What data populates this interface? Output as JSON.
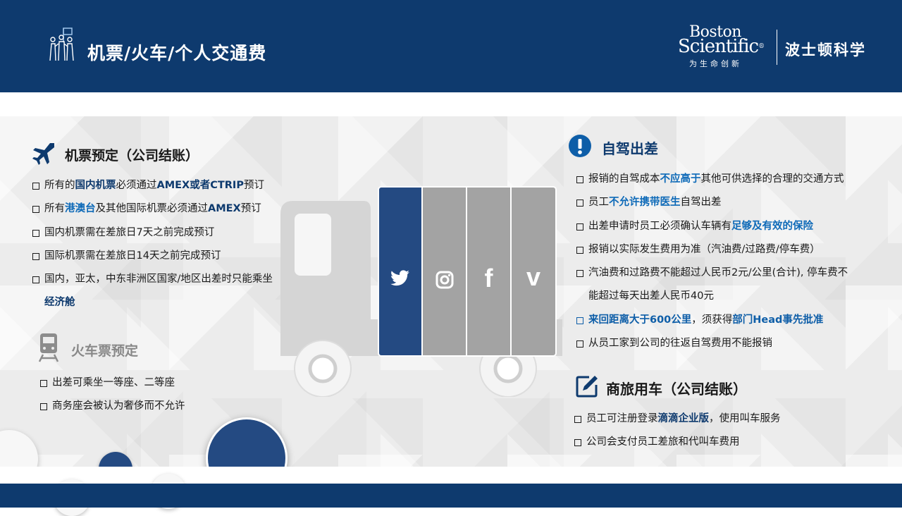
{
  "header": {
    "title": "机票/火车/个人交通费",
    "logo_line1": "Boston",
    "logo_line2": "Scientific",
    "logo_reg": "®",
    "logo_tagline": "为生命创新",
    "logo_cn": "波士顿科学"
  },
  "colors": {
    "navy": "#0e3a6e",
    "accent_blue": "#0e6ab8",
    "truck_grey": "#a3a3a3",
    "panel_navy": "#244a82"
  },
  "flight": {
    "title": "机票预定（公司结账）",
    "items": [
      [
        "所有的",
        "国内机票",
        "必须通过",
        "AMEX或者CTRIP",
        "预订"
      ],
      [
        "所有",
        "港澳台",
        "及其他国际机票必须通过",
        "AMEX",
        "预订"
      ],
      [
        "国内机票需在差旅日7天之前完成预订"
      ],
      [
        "国际机票需在差旅日14天之前完成预订"
      ],
      [
        "国内，亚太，中东非洲区国家/地区出差时只能乘坐"
      ],
      [
        "经济舱"
      ]
    ]
  },
  "train": {
    "title": "火车票预定",
    "items": [
      "出差可乘坐一等座、二等座",
      "商务座会被认为奢侈而不允许"
    ]
  },
  "truck": {
    "panels": [
      {
        "icon": "twitter-icon"
      },
      {
        "icon": "instagram-icon"
      },
      {
        "icon": "facebook-icon",
        "glyph": "f"
      },
      {
        "icon": "vimeo-icon",
        "glyph": "v"
      }
    ]
  },
  "selfdrive": {
    "title": "自驾出差",
    "items": [
      [
        "报销的自驾成本",
        "不应高于",
        "其他可供选择的合理的交通方式"
      ],
      [
        "员工",
        "不允许携带医生",
        "自驾出差"
      ],
      [
        "出差申请时员工必须确认车辆有",
        "足够及有效的保险",
        ""
      ],
      [
        "报销以实际发生费用为准（汽油费/过路费/停车费）"
      ],
      [
        "汽油费和过路费不能超过人民币2元/公里(合计), 停车费不"
      ],
      [
        "能超过每天出差人民币40元"
      ],
      [
        "来回距离大于600公里",
        "，须获得",
        "部门Head事先批准"
      ],
      [
        "从员工家到公司的往返自驾费用不能报销"
      ]
    ]
  },
  "carservice": {
    "title": "商旅用车（公司结账）",
    "items": [
      [
        "员工可注册登录",
        "滴滴企业版",
        "，使用叫车服务"
      ],
      [
        "公司会支付员工差旅和代叫车费用"
      ]
    ]
  }
}
